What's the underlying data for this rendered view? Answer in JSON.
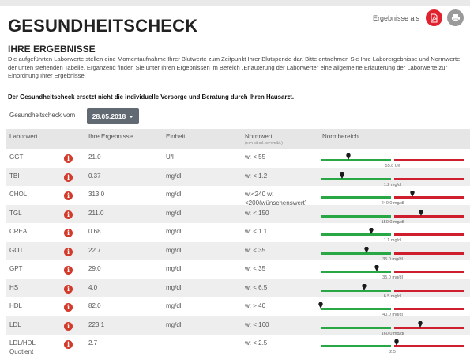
{
  "header": {
    "title": "GESUNDHEITSCHECK",
    "export_label": "Ergebnisse als",
    "pdf_icon": "pdf-icon",
    "print_icon": "printer-icon"
  },
  "results": {
    "heading": "IHRE ERGEBNISSE",
    "description": "Die aufgeführten Laborwerte stellen eine Momentaufnahme Ihrer Blutwerte zum Zeitpunkt Ihrer Blutspende dar. Bitte entnehmen Sie Ihre Laborergebnisse und Normwerte der unten stehenden Tabelle. Ergänzend finden Sie unter Ihren Ergebnissen im Bereich „Erläuterung der Laborwerte\" eine allgemeine Erläuterung der Laborwerte zur Einordnung Ihrer Ergebnisse.",
    "note": "Der Gesundheitscheck ersetzt nicht die individuelle Vorsorge und Beratung durch Ihren Hausarzt."
  },
  "filter": {
    "label": "Gesundheitscheck vom",
    "selected_date": "28.05.2018"
  },
  "table": {
    "headers": {
      "laborwert": "Laborwert",
      "ergebnis": "Ihre Ergebnisse",
      "einheit": "Einheit",
      "normwert": "Normwert",
      "normwert_hint": "(m=männl. w=weibl.)",
      "normbereich": "Normbereich"
    },
    "rows": [
      {
        "name": "GGT",
        "value": "21.0",
        "unit": "U/l",
        "norm": "w: < 55",
        "scale_label": "55.0 U/l",
        "norm_fraction": 0.49,
        "marker_fraction": 0.19
      },
      {
        "name": "TBI",
        "value": "0.37",
        "unit": "mg/dl",
        "norm": "w: < 1.2",
        "scale_label": "1.2 mg/dl",
        "norm_fraction": 0.49,
        "marker_fraction": 0.15
      },
      {
        "name": "CHOL",
        "value": "313.0",
        "unit": "mg/dl",
        "norm": "w:<240 w:\n<200(wünschenswert)",
        "scale_label": "240.0 mg/dl",
        "norm_fraction": 0.49,
        "marker_fraction": 0.64
      },
      {
        "name": "TGL",
        "value": "211.0",
        "unit": "mg/dl",
        "norm": "w: < 150",
        "scale_label": "150.0 mg/dl",
        "norm_fraction": 0.49,
        "marker_fraction": 0.7
      },
      {
        "name": "CREA",
        "value": "0.68",
        "unit": "mg/dl",
        "norm": "w: < 1.1",
        "scale_label": "1.1 mg/dl",
        "norm_fraction": 0.49,
        "marker_fraction": 0.35
      },
      {
        "name": "GOT",
        "value": "22.7",
        "unit": "mg/dl",
        "norm": "w: < 35",
        "scale_label": "35.0 mg/dl",
        "norm_fraction": 0.49,
        "marker_fraction": 0.32
      },
      {
        "name": "GPT",
        "value": "29.0",
        "unit": "mg/dl",
        "norm": "w: < 35",
        "scale_label": "35.0 mg/dl",
        "norm_fraction": 0.49,
        "marker_fraction": 0.39
      },
      {
        "name": "HS",
        "value": "4.0",
        "unit": "mg/dl",
        "norm": "w: < 6.5",
        "scale_label": "6.5 mg/dl",
        "norm_fraction": 0.49,
        "marker_fraction": 0.3
      },
      {
        "name": "HDL",
        "value": "82.0",
        "unit": "mg/dl",
        "norm": "w: > 40",
        "scale_label": "40.0 mg/dl",
        "norm_fraction": 0.49,
        "marker_fraction": 0.0
      },
      {
        "name": "LDL",
        "value": "223.1",
        "unit": "mg/dl",
        "norm": "w: < 160",
        "scale_label": "160.0 mg/dl",
        "norm_fraction": 0.49,
        "marker_fraction": 0.69
      },
      {
        "name": "LDL/HDL\nQuotient",
        "value": "2.7",
        "unit": "",
        "norm": "w: < 2.5",
        "scale_label": "2.5",
        "norm_fraction": 0.49,
        "marker_fraction": 0.53
      }
    ]
  },
  "colors": {
    "normal": "#27a844",
    "abnormal": "#cf1f2e",
    "info_icon": "#d23a2b",
    "pdf_button": "#e0212e",
    "print_button": "#9a9a9a"
  },
  "row_icon": "info-icon",
  "marker_icon": "pin-marker-icon"
}
